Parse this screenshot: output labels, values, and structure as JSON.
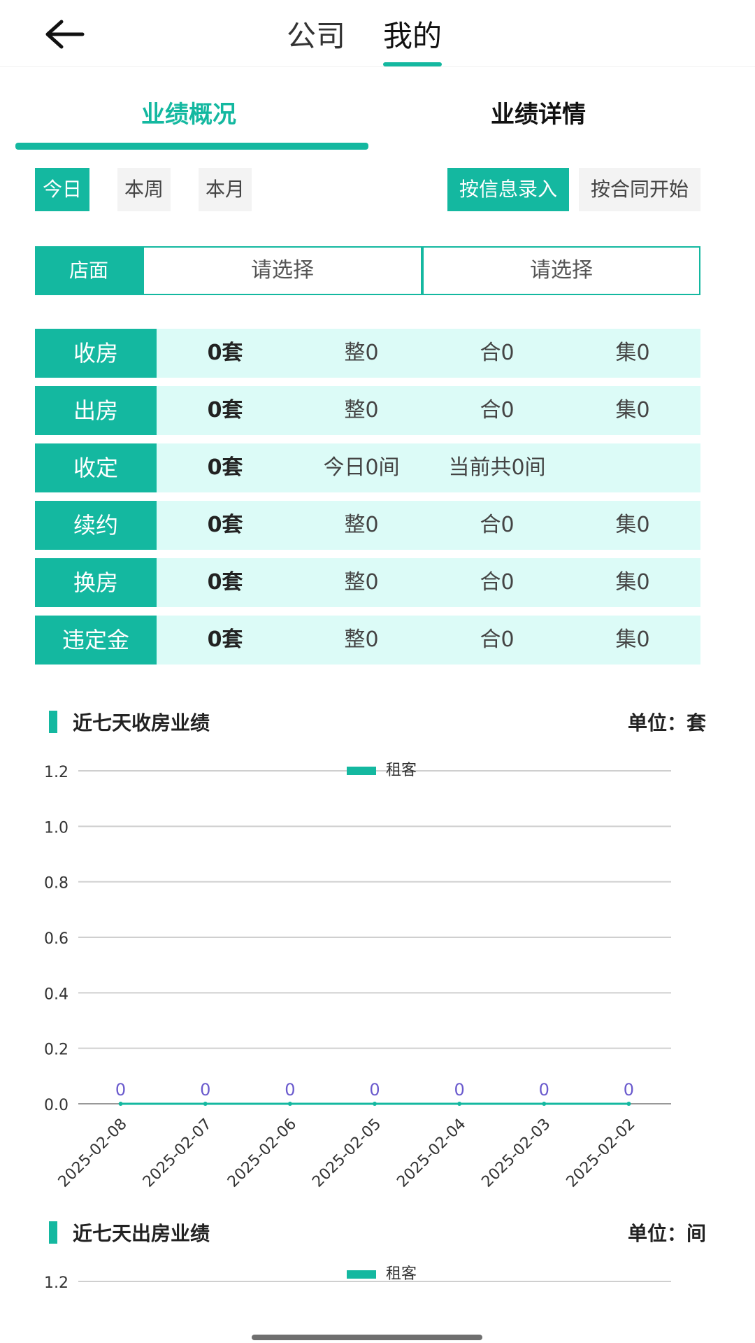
{
  "nav": {
    "tabs": [
      "公司",
      "我的"
    ],
    "active_tab": "我的"
  },
  "subtabs": {
    "overview": "业绩概况",
    "detail": "业绩详情"
  },
  "filters": {
    "period": [
      "今日",
      "本周",
      "本月"
    ],
    "active_period": "今日",
    "mode": [
      "按信息录入",
      "按合同开始"
    ],
    "active_mode": "按信息录入"
  },
  "store": {
    "label": "店面",
    "select1_placeholder": "请选择",
    "select2_placeholder": "请选择"
  },
  "stats": [
    {
      "label": "收房",
      "count": "0套",
      "c2": "整0",
      "c3": "合0",
      "c4": "集0"
    },
    {
      "label": "出房",
      "count": "0套",
      "c2": "整0",
      "c3": "合0",
      "c4": "集0"
    },
    {
      "label": "收定",
      "count": "0套",
      "c2": "今日0间",
      "c3": "当前共0间",
      "c4": ""
    },
    {
      "label": "续约",
      "count": "0套",
      "c2": "整0",
      "c3": "合0",
      "c4": "集0"
    },
    {
      "label": "换房",
      "count": "0套",
      "c2": "整0",
      "c3": "合0",
      "c4": "集0"
    },
    {
      "label": "违定金",
      "count": "0套",
      "c2": "整0",
      "c3": "合0",
      "c4": "集0"
    }
  ],
  "colors": {
    "accent": "#14b8a0",
    "row_bg": "#dcfbf7",
    "label_value": "#6a5acd",
    "grid": "#cfcfcf"
  },
  "chart_data": [
    {
      "type": "line",
      "title": "近七天收房业绩",
      "unit": "单位：套",
      "legend": "租客",
      "categories": [
        "2025-02-08",
        "2025-02-07",
        "2025-02-06",
        "2025-02-05",
        "2025-02-04",
        "2025-02-03",
        "2025-02-02"
      ],
      "series": [
        {
          "name": "租客",
          "values": [
            0,
            0,
            0,
            0,
            0,
            0,
            0
          ]
        }
      ],
      "yticks": [
        "0.0",
        "0.2",
        "0.4",
        "0.6",
        "0.8",
        "1.0",
        "1.2"
      ],
      "ylim": [
        0,
        1.2
      ],
      "grid": true,
      "legend_position": "top-center"
    },
    {
      "type": "line",
      "title": "近七天出房业绩",
      "unit": "单位：间",
      "legend": "租客",
      "yticks": [
        "1.2"
      ],
      "ylim": [
        0,
        1.2
      ],
      "grid": true,
      "legend_position": "top-center"
    }
  ]
}
